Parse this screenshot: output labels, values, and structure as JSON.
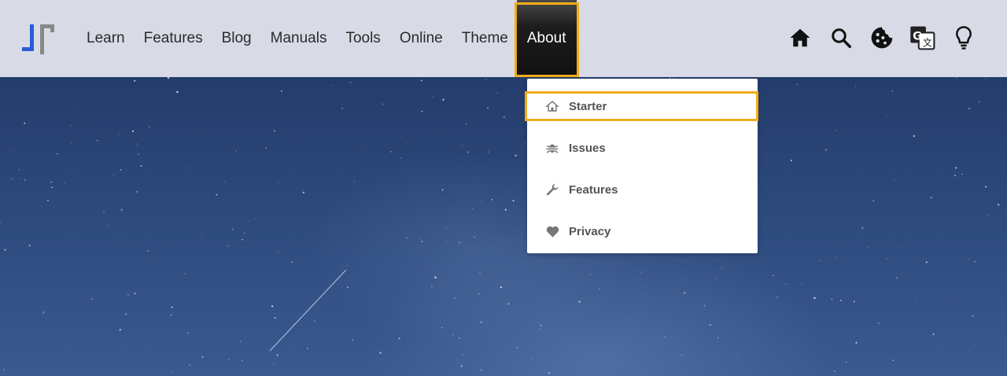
{
  "nav": {
    "items": [
      {
        "label": "Learn"
      },
      {
        "label": "Features"
      },
      {
        "label": "Blog"
      },
      {
        "label": "Manuals"
      },
      {
        "label": "Tools"
      },
      {
        "label": "Online"
      },
      {
        "label": "Theme"
      },
      {
        "label": "About",
        "active": true
      }
    ]
  },
  "header_icons": [
    "home-icon",
    "search-icon",
    "cookie-icon",
    "translate-icon",
    "lightbulb-icon"
  ],
  "dropdown": {
    "items": [
      {
        "label": "Starter",
        "icon": "home-outline-icon",
        "highlighted": true
      },
      {
        "label": "Issues",
        "icon": "bug-icon"
      },
      {
        "label": "Features",
        "icon": "wrench-icon"
      },
      {
        "label": "Privacy",
        "icon": "heart-icon"
      }
    ]
  },
  "colors": {
    "header_bg": "#d8dbe6",
    "active_bg": "#1c1c1c",
    "highlight_border": "#f0ad1a",
    "hero_bg": "#2e4a7c",
    "logo_blue": "#2a5bd7",
    "logo_grey": "#888888"
  }
}
